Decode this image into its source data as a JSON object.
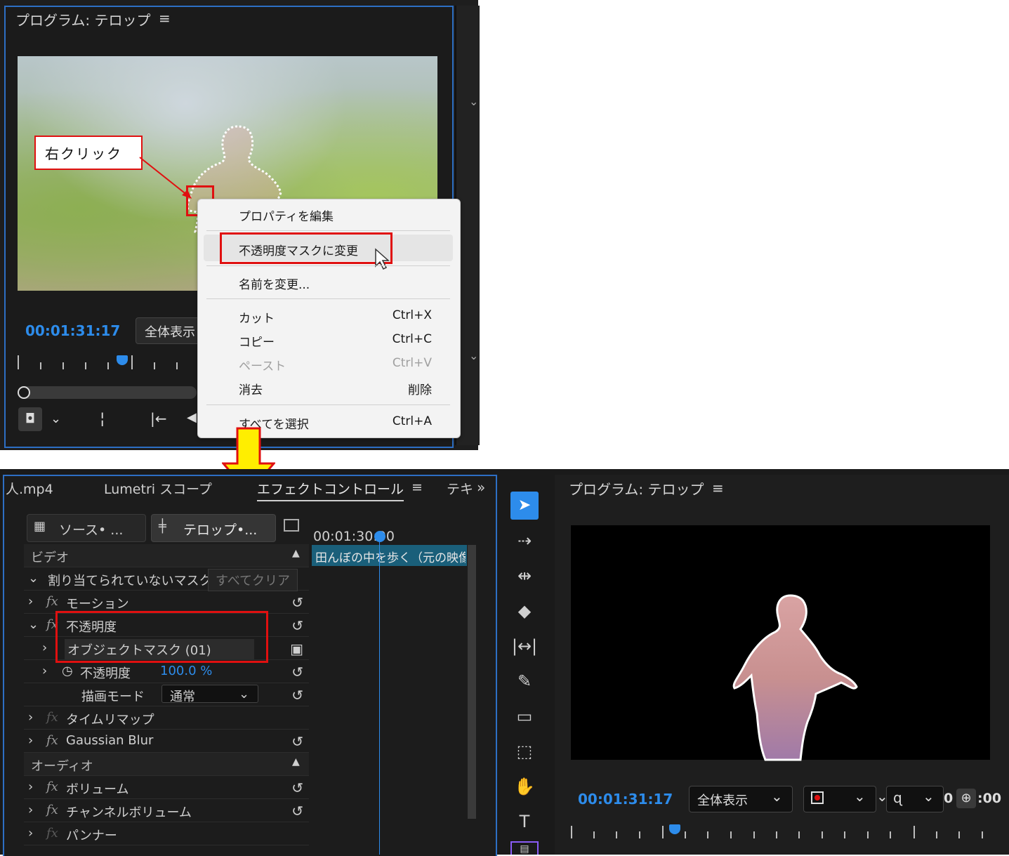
{
  "top_monitor": {
    "title": "プログラム: テロップ",
    "menu_icon": "hamburger-icon",
    "timecode": "00:01:31:17",
    "zoom_label": "全体表示",
    "callout_label": "右クリック"
  },
  "context_menu": {
    "items": [
      {
        "label": "プロパティを編集",
        "shortcut": ""
      },
      {
        "label": "不透明度マスクに変更",
        "shortcut": ""
      },
      {
        "label": "名前を変更...",
        "shortcut": ""
      },
      {
        "label": "カット",
        "shortcut": "Ctrl+X"
      },
      {
        "label": "コピー",
        "shortcut": "Ctrl+C"
      },
      {
        "label": "ペースト",
        "shortcut": "Ctrl+V"
      },
      {
        "label": "消去",
        "shortcut": "削除"
      },
      {
        "label": "すべてを選択",
        "shortcut": "Ctrl+A"
      }
    ]
  },
  "effect_panel": {
    "tabs": [
      "人.mp4",
      "Lumetri スコープ",
      "エフェクトコントロール",
      "テキ"
    ],
    "active_tab_menu": "≡",
    "overflow": "»",
    "source_label": "ソース• ...",
    "sequence_label": "テロップ•...",
    "timeline_time": "00:01:30:00",
    "clip_label": "田んぼの中を歩く（元の映像",
    "video_header": "ビデオ",
    "unassigned_mask": "割り当てられていないマスク",
    "clear_all": "すべてクリア",
    "motion": "モーション",
    "opacity": "不透明度",
    "object_mask": "オブジェクトマスク (01)",
    "opacity_param": "不透明度",
    "opacity_value": "100.0 %",
    "blend_mode_label": "描画モード",
    "blend_mode_value": "通常",
    "time_remap": "タイムリマップ",
    "gaussian_blur": "Gaussian Blur",
    "audio_header": "オーディオ",
    "volume": "ボリューム",
    "channel_volume": "チャンネルボリューム",
    "panner": "パンナー",
    "fx_symbol": "fx"
  },
  "bottom_monitor": {
    "title": "プログラム: テロップ",
    "menu_icon": "hamburger-icon",
    "timecode": "00:01:31:17",
    "zoom_label": "全体表示",
    "end_time_fragment": "0",
    "end_time_fragment2": ":00"
  },
  "colors": {
    "accent_blue": "#2d8ceb",
    "highlight_red": "#e01010",
    "arrow_yellow": "#ffee00"
  }
}
